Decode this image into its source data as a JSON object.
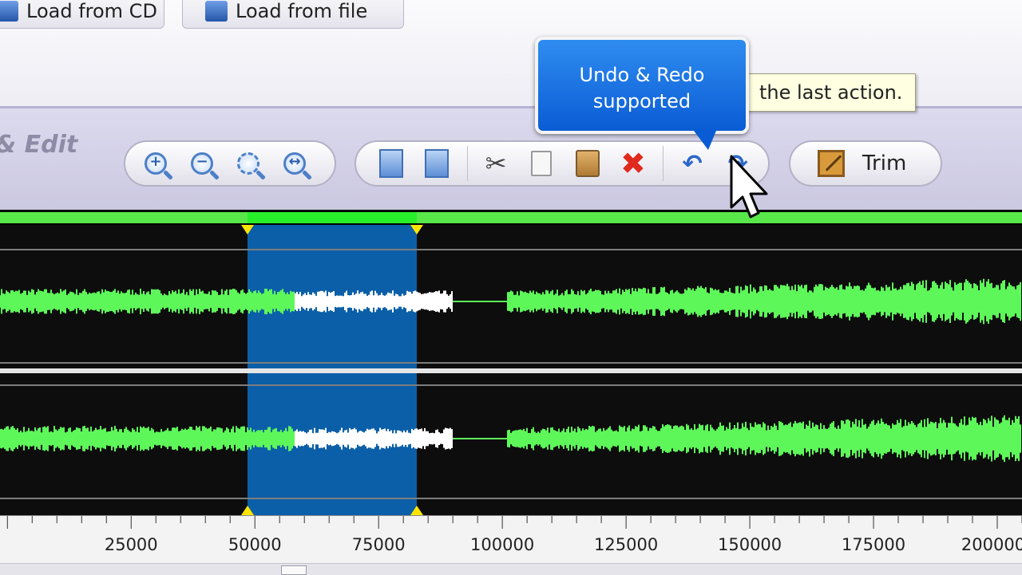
{
  "load": {
    "cd_label": "Load from CD",
    "file_label": "Load from file"
  },
  "edit_panel": {
    "title": "& Edit",
    "zoom_tools": [
      {
        "name": "zoom-in-icon",
        "glyph": "+"
      },
      {
        "name": "zoom-out-icon",
        "glyph": "−"
      },
      {
        "name": "zoom-selection-icon",
        "glyph": ""
      },
      {
        "name": "zoom-fit-icon",
        "glyph": "↔"
      }
    ],
    "trim_label": "Trim"
  },
  "tooltip": {
    "text": "the last action."
  },
  "callout": {
    "line1": "Undo & Redo",
    "line2": "supported"
  },
  "waveform": {
    "colors": {
      "wave": "#5ef75a",
      "selected_wave": "#ffffff",
      "selection": "#0b5fa8",
      "marker": "#ffe400"
    },
    "selection_range": [
      58000,
      90000
    ],
    "silence_range": [
      90000,
      101000
    ]
  },
  "ruler": {
    "range": [
      -1500,
      205000
    ],
    "labels": [
      "25000",
      "50000",
      "75000",
      "100000",
      "125000",
      "150000",
      "175000",
      "200000"
    ]
  }
}
